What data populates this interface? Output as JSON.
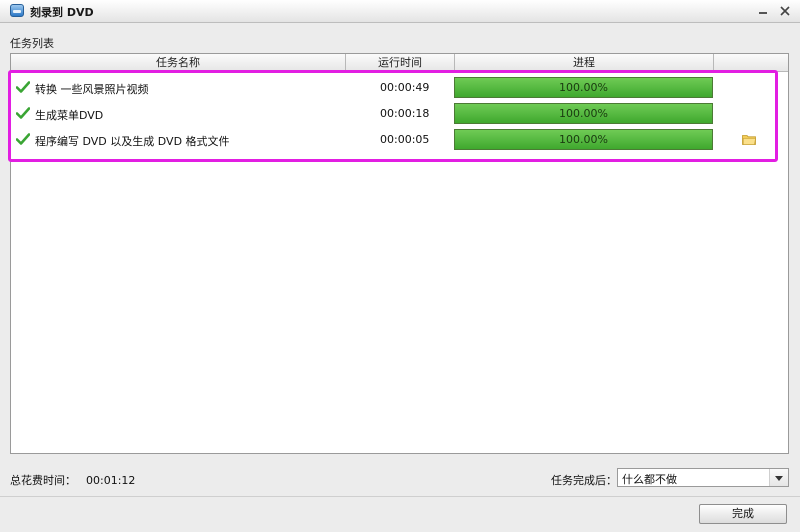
{
  "window": {
    "title": "刻录到 DVD"
  },
  "task_list": {
    "label": "任务列表",
    "columns": [
      "任务名称",
      "运行时间",
      "进程",
      ""
    ],
    "rows": [
      {
        "name": "转换 一些风景照片视频",
        "time": "00:00:49",
        "progress_text": "100.00%",
        "progress": 1.0,
        "status_icon": "check-icon"
      },
      {
        "name": "生成菜单DVD",
        "time": "00:00:18",
        "progress_text": "100.00%",
        "progress": 1.0,
        "status_icon": "check-icon"
      },
      {
        "name": "程序编写 DVD 以及生成 DVD 格式文件",
        "time": "00:00:05",
        "progress_text": "100.00%",
        "progress": 1.0,
        "status_icon": "check-icon",
        "extra_icon": "folder-icon"
      }
    ]
  },
  "footer": {
    "total_label": "总花费时间：",
    "total_value": "00:01:12",
    "after_label": "任务完成后：",
    "after_value": "什么都不做",
    "done_label": "完成"
  },
  "colors": {
    "progress_green": "#4fb83a",
    "highlight": "#e21ee2",
    "check_green": "#3aa534"
  }
}
